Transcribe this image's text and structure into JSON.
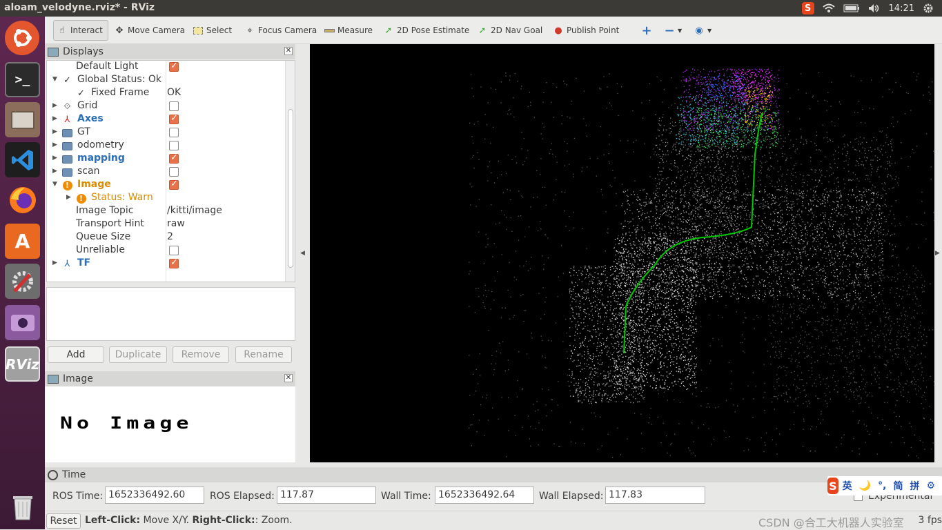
{
  "system": {
    "window_title": "aloam_velodyne.rviz* - RViz",
    "time": "14:21",
    "tray_icons": [
      "sogou-icon",
      "wifi-icon",
      "battery-icon",
      "volume-icon",
      "settings-icon"
    ]
  },
  "launcher": {
    "items": [
      "ubuntu-dash",
      "terminal",
      "files",
      "vscode",
      "firefox",
      "software-center",
      "system-settings",
      "cheese-camera",
      "rviz",
      "trash"
    ],
    "rviz_label": "RViz"
  },
  "toolbar": {
    "interact": "Interact",
    "move_camera": "Move Camera",
    "select": "Select",
    "focus_camera": "Focus Camera",
    "measure": "Measure",
    "pose_estimate": "2D Pose Estimate",
    "nav_goal": "2D Nav Goal",
    "publish_point": "Publish Point"
  },
  "displays": {
    "title": "Displays",
    "rows": [
      {
        "label": "Default Light",
        "checked": true
      },
      {
        "label": "Global Status: Ok"
      },
      {
        "label": "Fixed Frame",
        "value": "OK"
      },
      {
        "label": "Grid",
        "checked": false
      },
      {
        "label": "Axes",
        "checked": true
      },
      {
        "label": "GT",
        "checked": false
      },
      {
        "label": "odometry",
        "checked": false
      },
      {
        "label": "mapping",
        "checked": true
      },
      {
        "label": "scan",
        "checked": false
      },
      {
        "label": "Image",
        "checked": true
      },
      {
        "label": "Status: Warn"
      },
      {
        "label": "Image Topic",
        "value": "/kitti/image"
      },
      {
        "label": "Transport Hint",
        "value": "raw"
      },
      {
        "label": "Queue Size",
        "value": "2"
      },
      {
        "label": "Unreliable",
        "checked": false
      },
      {
        "label": "TF",
        "checked": true
      }
    ],
    "buttons": {
      "add": "Add",
      "duplicate": "Duplicate",
      "remove": "Remove",
      "rename": "Rename"
    }
  },
  "image_panel": {
    "title": "Image",
    "message": "No Image"
  },
  "time_panel": {
    "title": "Time",
    "ros_time_label": "ROS Time:",
    "ros_time": "1652336492.60",
    "ros_elapsed_label": "ROS Elapsed:",
    "ros_elapsed": "117.87",
    "wall_time_label": "Wall Time:",
    "wall_time": "1652336492.64",
    "wall_elapsed_label": "Wall Elapsed:",
    "wall_elapsed": "117.83",
    "experimental": "Experimental"
  },
  "statusbar": {
    "reset": "Reset",
    "left_click_bold": "Left-Click:",
    "left_click_text": " Move X/Y. ",
    "right_click_bold": "Right-Click:",
    "right_click_text": ": Zoom.",
    "fps": "3 fps",
    "watermark": "CSDN @合工大机器人实验室"
  },
  "ime": {
    "logo": "S",
    "items": [
      "英",
      "🌙",
      "°,",
      "简",
      "拼",
      "⚙"
    ]
  },
  "colors": {
    "launcher": "#5e2750",
    "accent_check": "#e7714a",
    "link_blue": "#2a6fb8",
    "warn_orange": "#d98c00",
    "trajectory": "#00c800"
  }
}
